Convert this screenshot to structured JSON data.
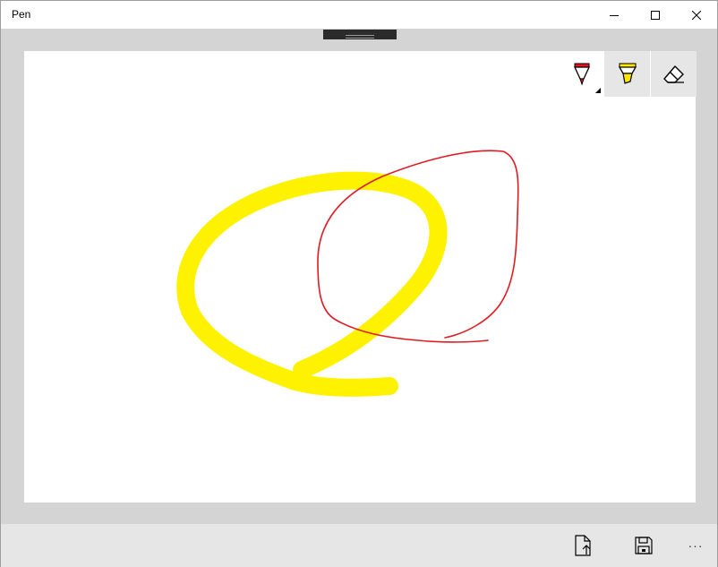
{
  "window": {
    "title": "Pen",
    "controls": {
      "minimize_icon": "minimize-icon",
      "maximize_icon": "maximize-icon",
      "close_icon": "close-icon"
    }
  },
  "canvas_tools": [
    {
      "name": "pen",
      "icon": "pen-icon",
      "color": "#e81123",
      "selected": false
    },
    {
      "name": "highlighter",
      "icon": "highlighter-icon",
      "color": "#ffe600",
      "selected": true
    },
    {
      "name": "eraser",
      "icon": "eraser-icon",
      "selected": true
    }
  ],
  "strokes": {
    "highlighter_color": "#fff200",
    "pen_color": "#e01b24"
  },
  "bottom_bar": {
    "share_icon": "share-file-icon",
    "save_icon": "save-icon",
    "more": "···"
  }
}
